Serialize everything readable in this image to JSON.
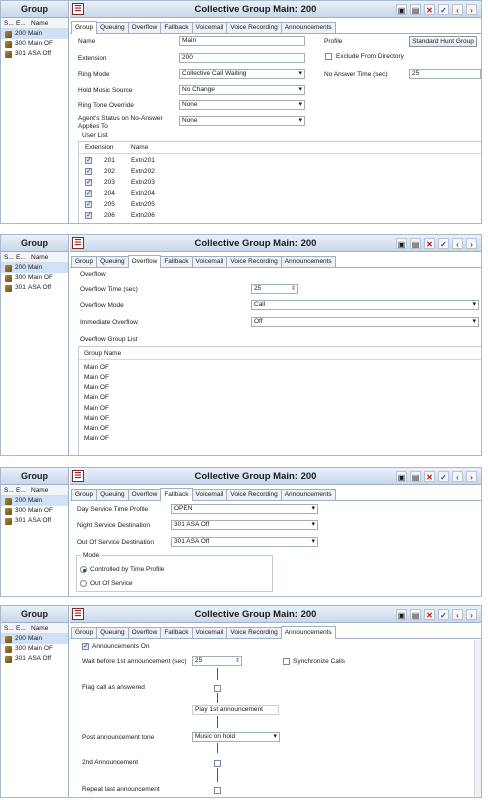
{
  "left_panel": {
    "title": "Group",
    "columns": [
      "S...",
      "E...",
      "Name"
    ],
    "rows": [
      {
        "ext": "200",
        "name": "Main"
      },
      {
        "ext": "300",
        "name": "Main OF"
      },
      {
        "ext": "301",
        "name": "ASA Off"
      }
    ]
  },
  "window_title": "Collective Group Main: 200",
  "tabs": [
    "Group",
    "Queuing",
    "Overflow",
    "Fallback",
    "Voicemail",
    "Voice Recording",
    "Announcements"
  ],
  "group_tab": {
    "name_label": "Name",
    "name_value": "Main",
    "extension_label": "Extension",
    "extension_value": "200",
    "ring_mode_label": "Ring Mode",
    "ring_mode_value": "Collective Call Waiting",
    "hold_music_label": "Hold Music Source",
    "hold_music_value": "No Change",
    "ring_tone_label": "Ring Tone Override",
    "ring_tone_value": "None",
    "agent_status_label": "Agent's Status on No-Answer Applies To",
    "agent_status_value": "None",
    "profile_label": "Profile",
    "profile_button": "Standard Hunt Group",
    "exclude_label": "Exclude From Directory",
    "no_answer_label": "No Answer Time (sec)",
    "no_answer_value": "25",
    "user_list_label": "User List",
    "user_cols": [
      "Extension",
      "Name"
    ],
    "users": [
      {
        "ext": "201",
        "name": "Extn201"
      },
      {
        "ext": "202",
        "name": "Extn202"
      },
      {
        "ext": "203",
        "name": "Extn203"
      },
      {
        "ext": "204",
        "name": "Extn204"
      },
      {
        "ext": "205",
        "name": "Extn205"
      },
      {
        "ext": "206",
        "name": "Extn206"
      }
    ]
  },
  "overflow_tab": {
    "section": "Overflow",
    "time_label": "Overflow Time (sec)",
    "time_value": "25",
    "mode_label": "Overflow Mode",
    "mode_value": "Call",
    "immediate_label": "Immediate Overflow",
    "immediate_value": "Off",
    "list_label": "Overflow Group List",
    "list_col": "Group Name",
    "groups": [
      "Main OF",
      "Main OF",
      "Main OF",
      "Main OF",
      "Main OF",
      "Main OF",
      "Main OF",
      "Main OF"
    ]
  },
  "fallback_tab": {
    "day_label": "Day Service Time Profile",
    "day_value": "OPEN",
    "night_label": "Night Service Destination",
    "night_value": "301 ASA Off",
    "oos_label": "Out Of Service Destination",
    "oos_value": "301 ASA Off",
    "mode_label": "Mode",
    "mode_opt1": "Controlled by Time Profile",
    "mode_opt2": "Out Of Service"
  },
  "announcements_tab": {
    "on_label": "Announcements On",
    "wait_label": "Wait before 1st announcement (sec)",
    "wait_value": "25",
    "sync_label": "Synchronize Calls",
    "flag_label": "Flag call as answered",
    "play_label": "Play 1st announcement",
    "tone_label": "Post announcement tone",
    "tone_value": "Music on hold",
    "second_label": "2nd Announcement",
    "repeat_label": "Repeat last announcement"
  }
}
